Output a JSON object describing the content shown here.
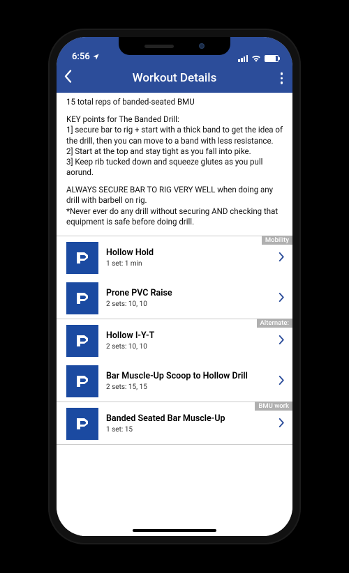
{
  "status": {
    "time": "6:56",
    "locationArrow": "➤"
  },
  "nav": {
    "title": "Workout Details"
  },
  "instructions": {
    "line1": "15 total reps of banded-seated BMU",
    "keyHeader": "KEY points for The Banded Drill:",
    "k1": "1] secure bar to rig + start with a thick band to get the idea of the drill, then you can move to a band with less resistance.",
    "k2": "2] Start at the top and stay tight as you fall into pike.",
    "k3": "3] Keep rib tucked down and squeeze glutes as you pull aorund.",
    "warn1": "ALWAYS SECURE BAR TO RIG VERY WELL when doing any drill with barbell on rig.",
    "warn2": "*Never ever do any drill without securing AND checking that equipment is safe before doing drill."
  },
  "sections": [
    {
      "tag": "Mobility",
      "items": [
        {
          "title": "Hollow Hold",
          "sub": "1 set: 1 min"
        },
        {
          "title": "Prone PVC Raise",
          "sub": "2 sets: 10, 10"
        }
      ]
    },
    {
      "tag": "Alternate:",
      "items": [
        {
          "title": "Hollow I-Y-T",
          "sub": "2 sets: 10, 10"
        },
        {
          "title": "Bar Muscle-Up Scoop to Hollow Drill",
          "sub": "2 sets: 15, 15"
        }
      ]
    },
    {
      "tag": "BMU work",
      "items": [
        {
          "title": "Banded Seated Bar Muscle-Up",
          "sub": "1 set: 15"
        }
      ]
    }
  ]
}
